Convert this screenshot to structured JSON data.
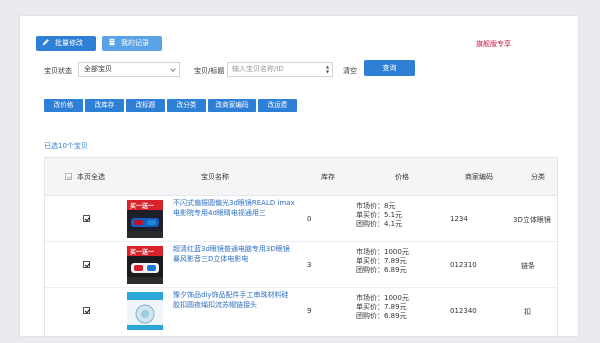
{
  "toolbar": {
    "batch_edit_label": "批量修改",
    "my_records_label": "我的记录",
    "promo_text": "旗舰版专享"
  },
  "filters": {
    "status_label": "宝贝状态",
    "status_value": "全部宝贝",
    "title_label": "宝贝/标题",
    "title_placeholder": "输入宝贝名称/ID",
    "clear_label": "清空",
    "search_label": "查询"
  },
  "actions": [
    "改价格",
    "改库存",
    "改标题",
    "改分类",
    "改商家编码",
    "改运费"
  ],
  "selected_text": "已选10个宝贝",
  "table": {
    "headers": {
      "select_all": "本页全选",
      "name": "宝贝名称",
      "stock": "库存",
      "price": "价格",
      "code": "商家编码",
      "category": "分类"
    },
    "rows": [
      {
        "name": "不闪式偏振圆偏光3d眼镜REALD imax电影院专用4d眼睛电视通用三",
        "stock": "0",
        "market_price": "市场价：8元",
        "single_price": "单买价：5.1元",
        "group_price": "团购价：4.1元",
        "code": "1234",
        "category": "3D立体眼镜",
        "thumb_text": "买一送一"
      },
      {
        "name": "超清红蓝3d眼镜普通电脑专用3D眼镜 暴风影音三D立体电影电",
        "stock": "3",
        "market_price": "市场价：1000元",
        "single_price": "单买价：7.89元",
        "group_price": "团购价：6.89元",
        "code": "012310",
        "category": "链条",
        "thumb_text": "买一送一"
      },
      {
        "name": "豫夕饰品diy饰品配件手工串珠材料硅胶扣圆夜绳扣流苏帽链接头",
        "stock": "9",
        "market_price": "市场价：1000元",
        "single_price": "单买价：7.89元",
        "group_price": "团购价：6.89元",
        "code": "012340",
        "category": "扣",
        "thumb_text": ""
      }
    ]
  },
  "colors": {
    "primary": "#2e7fd6",
    "primary_light": "#5aa3e6",
    "promo": "#c81d48",
    "link": "#2e6fc4"
  }
}
